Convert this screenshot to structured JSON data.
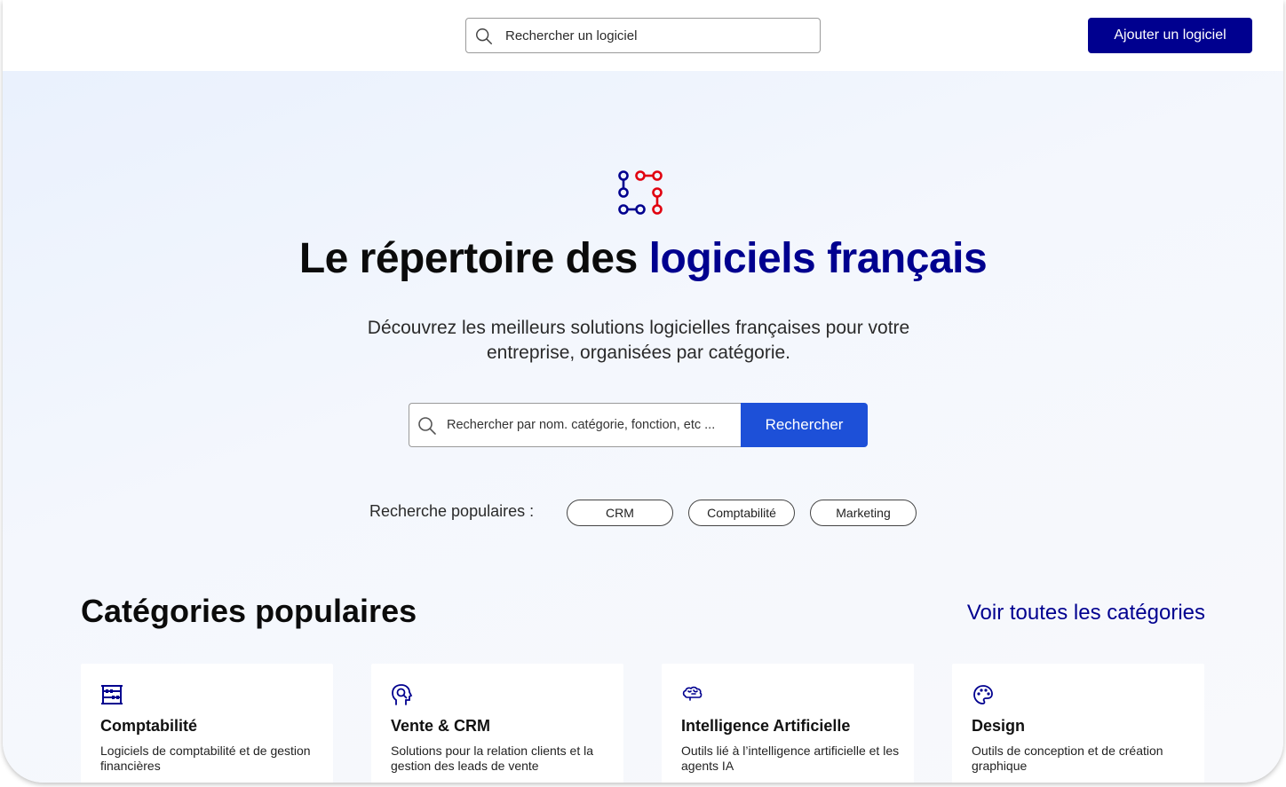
{
  "header": {
    "search_placeholder": "Rechercher un logiciel",
    "add_button": "Ajouter un logiciel"
  },
  "hero": {
    "title_plain": "Le répertoire des ",
    "title_accent": "logiciels français",
    "subtitle": "Découvrez les meilleurs solutions logicielles françaises pour votre entreprise, organisées par catégorie.",
    "search_placeholder": "Rechercher par nom. catégorie, fonction, etc ...",
    "search_button": "Rechercher",
    "popular_label": "Recherche populaires :",
    "popular_chips": [
      "CRM",
      "Comptabilité",
      "Marketing"
    ]
  },
  "categories": {
    "title": "Catégories populaires",
    "see_all": "Voir toutes les catégories",
    "items": [
      {
        "name": "Comptabilité",
        "description": "Logiciels de comptabilité et de gestion financières",
        "icon": "abacus-icon"
      },
      {
        "name": "Vente & CRM",
        "description": "Solutions pour la relation clients et la gestion des leads de vente",
        "icon": "customer-search-icon"
      },
      {
        "name": "Intelligence Artificielle",
        "description": "Outils lié à l’intelligence artificielle et les agents IA",
        "icon": "brain-icon"
      },
      {
        "name": "Design",
        "description": "Outils de conception et de création graphique",
        "icon": "palette-icon"
      }
    ]
  },
  "colors": {
    "brand_blue": "#00008f",
    "action_blue": "#1d50d8",
    "logo_red": "#e1000f"
  }
}
